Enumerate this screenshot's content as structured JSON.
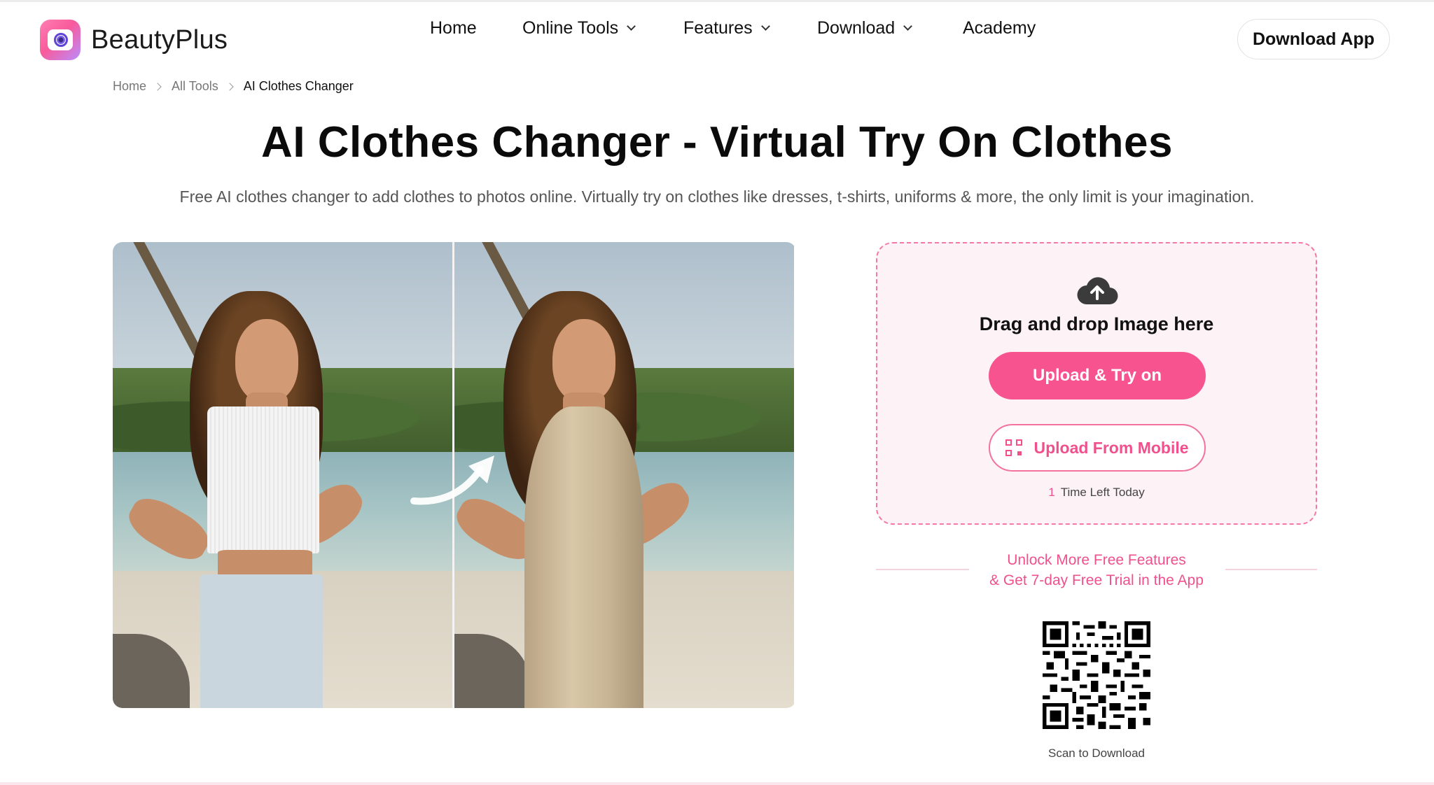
{
  "brand": {
    "name": "BeautyPlus"
  },
  "nav": {
    "items": [
      {
        "label": "Home",
        "has_dropdown": false
      },
      {
        "label": "Online Tools",
        "has_dropdown": true
      },
      {
        "label": "Features",
        "has_dropdown": true
      },
      {
        "label": "Download",
        "has_dropdown": true
      },
      {
        "label": "Academy",
        "has_dropdown": false
      }
    ],
    "cta_label": "Download App"
  },
  "breadcrumb": [
    "Home",
    "All Tools",
    "AI Clothes Changer"
  ],
  "hero": {
    "title": "AI Clothes Changer - Virtual Try On Clothes",
    "subtitle": "Free AI clothes changer to add clothes to photos online. Virtually try on clothes like dresses, t-shirts, uniforms & more, the only limit is your imagination."
  },
  "upload": {
    "icon": "cloud-upload-icon",
    "drag_text": "Drag and drop Image here",
    "primary_button": "Upload & Try on",
    "mobile_button": "Upload From Mobile",
    "mobile_icon": "qr-code-icon",
    "times_left_count": "1",
    "times_left_label": "Time Left Today"
  },
  "promo": {
    "line1": "Unlock More Free Features",
    "line2": "& Get 7-day Free Trial in the App"
  },
  "qr": {
    "caption": "Scan to Download"
  },
  "colors": {
    "accent": "#f7548f",
    "card_bg": "#fdf2f6",
    "card_border": "#f37aa8"
  }
}
